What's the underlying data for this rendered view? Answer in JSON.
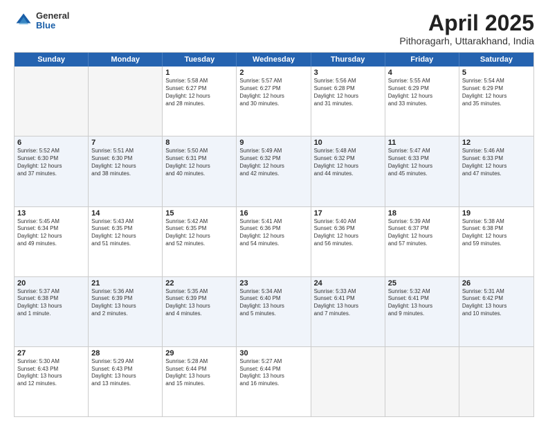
{
  "logo": {
    "general": "General",
    "blue": "Blue"
  },
  "title": "April 2025",
  "location": "Pithoragarh, Uttarakhand, India",
  "weekdays": [
    "Sunday",
    "Monday",
    "Tuesday",
    "Wednesday",
    "Thursday",
    "Friday",
    "Saturday"
  ],
  "rows": [
    [
      {
        "day": "",
        "info": ""
      },
      {
        "day": "",
        "info": ""
      },
      {
        "day": "1",
        "info": "Sunrise: 5:58 AM\nSunset: 6:27 PM\nDaylight: 12 hours\nand 28 minutes."
      },
      {
        "day": "2",
        "info": "Sunrise: 5:57 AM\nSunset: 6:27 PM\nDaylight: 12 hours\nand 30 minutes."
      },
      {
        "day": "3",
        "info": "Sunrise: 5:56 AM\nSunset: 6:28 PM\nDaylight: 12 hours\nand 31 minutes."
      },
      {
        "day": "4",
        "info": "Sunrise: 5:55 AM\nSunset: 6:29 PM\nDaylight: 12 hours\nand 33 minutes."
      },
      {
        "day": "5",
        "info": "Sunrise: 5:54 AM\nSunset: 6:29 PM\nDaylight: 12 hours\nand 35 minutes."
      }
    ],
    [
      {
        "day": "6",
        "info": "Sunrise: 5:52 AM\nSunset: 6:30 PM\nDaylight: 12 hours\nand 37 minutes."
      },
      {
        "day": "7",
        "info": "Sunrise: 5:51 AM\nSunset: 6:30 PM\nDaylight: 12 hours\nand 38 minutes."
      },
      {
        "day": "8",
        "info": "Sunrise: 5:50 AM\nSunset: 6:31 PM\nDaylight: 12 hours\nand 40 minutes."
      },
      {
        "day": "9",
        "info": "Sunrise: 5:49 AM\nSunset: 6:32 PM\nDaylight: 12 hours\nand 42 minutes."
      },
      {
        "day": "10",
        "info": "Sunrise: 5:48 AM\nSunset: 6:32 PM\nDaylight: 12 hours\nand 44 minutes."
      },
      {
        "day": "11",
        "info": "Sunrise: 5:47 AM\nSunset: 6:33 PM\nDaylight: 12 hours\nand 45 minutes."
      },
      {
        "day": "12",
        "info": "Sunrise: 5:46 AM\nSunset: 6:33 PM\nDaylight: 12 hours\nand 47 minutes."
      }
    ],
    [
      {
        "day": "13",
        "info": "Sunrise: 5:45 AM\nSunset: 6:34 PM\nDaylight: 12 hours\nand 49 minutes."
      },
      {
        "day": "14",
        "info": "Sunrise: 5:43 AM\nSunset: 6:35 PM\nDaylight: 12 hours\nand 51 minutes."
      },
      {
        "day": "15",
        "info": "Sunrise: 5:42 AM\nSunset: 6:35 PM\nDaylight: 12 hours\nand 52 minutes."
      },
      {
        "day": "16",
        "info": "Sunrise: 5:41 AM\nSunset: 6:36 PM\nDaylight: 12 hours\nand 54 minutes."
      },
      {
        "day": "17",
        "info": "Sunrise: 5:40 AM\nSunset: 6:36 PM\nDaylight: 12 hours\nand 56 minutes."
      },
      {
        "day": "18",
        "info": "Sunrise: 5:39 AM\nSunset: 6:37 PM\nDaylight: 12 hours\nand 57 minutes."
      },
      {
        "day": "19",
        "info": "Sunrise: 5:38 AM\nSunset: 6:38 PM\nDaylight: 12 hours\nand 59 minutes."
      }
    ],
    [
      {
        "day": "20",
        "info": "Sunrise: 5:37 AM\nSunset: 6:38 PM\nDaylight: 13 hours\nand 1 minute."
      },
      {
        "day": "21",
        "info": "Sunrise: 5:36 AM\nSunset: 6:39 PM\nDaylight: 13 hours\nand 2 minutes."
      },
      {
        "day": "22",
        "info": "Sunrise: 5:35 AM\nSunset: 6:39 PM\nDaylight: 13 hours\nand 4 minutes."
      },
      {
        "day": "23",
        "info": "Sunrise: 5:34 AM\nSunset: 6:40 PM\nDaylight: 13 hours\nand 5 minutes."
      },
      {
        "day": "24",
        "info": "Sunrise: 5:33 AM\nSunset: 6:41 PM\nDaylight: 13 hours\nand 7 minutes."
      },
      {
        "day": "25",
        "info": "Sunrise: 5:32 AM\nSunset: 6:41 PM\nDaylight: 13 hours\nand 9 minutes."
      },
      {
        "day": "26",
        "info": "Sunrise: 5:31 AM\nSunset: 6:42 PM\nDaylight: 13 hours\nand 10 minutes."
      }
    ],
    [
      {
        "day": "27",
        "info": "Sunrise: 5:30 AM\nSunset: 6:43 PM\nDaylight: 13 hours\nand 12 minutes."
      },
      {
        "day": "28",
        "info": "Sunrise: 5:29 AM\nSunset: 6:43 PM\nDaylight: 13 hours\nand 13 minutes."
      },
      {
        "day": "29",
        "info": "Sunrise: 5:28 AM\nSunset: 6:44 PM\nDaylight: 13 hours\nand 15 minutes."
      },
      {
        "day": "30",
        "info": "Sunrise: 5:27 AM\nSunset: 6:44 PM\nDaylight: 13 hours\nand 16 minutes."
      },
      {
        "day": "",
        "info": ""
      },
      {
        "day": "",
        "info": ""
      },
      {
        "day": "",
        "info": ""
      }
    ]
  ]
}
